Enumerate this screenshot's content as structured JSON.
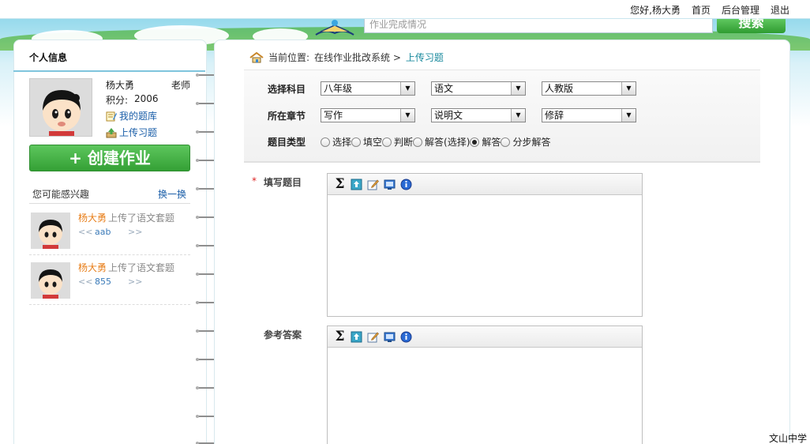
{
  "topbar": {
    "nav": [
      "您好,杨大勇",
      "首页",
      "后台管理",
      "退出"
    ]
  },
  "search": {
    "placeholder": "作业完成情况",
    "button_label": "搜索"
  },
  "sidebar": {
    "title": "个人信息",
    "teacher": {
      "name": "杨大勇",
      "role": "老师",
      "score_label": "积分:",
      "score": "2006"
    },
    "links": [
      {
        "label": "我的题库",
        "icon": "notepad-icon"
      },
      {
        "label": "上传习题",
        "icon": "upload-icon"
      }
    ],
    "create_button": "+ 创建作业",
    "interest": {
      "label": "您可能感兴趣",
      "refresh": "换一换",
      "items": [
        {
          "user": "杨大勇",
          "action": "上传了语文套题",
          "prev": "<<",
          "title": "aab",
          "next": ">>"
        },
        {
          "user": "杨大勇",
          "action": "上传了语文套题",
          "prev": "<<",
          "title": "855",
          "next": ">>"
        }
      ]
    }
  },
  "breadcrumb": {
    "prefix": "当前位置:",
    "path": "在线作业批改系统 >",
    "current": "上传习题"
  },
  "form": {
    "subject": {
      "label": "选择科目",
      "selects": [
        "八年级",
        "语文",
        "人教版"
      ]
    },
    "chapter": {
      "label": "所在章节",
      "selects": [
        "写作",
        "说明文",
        "修辞"
      ]
    },
    "type": {
      "label": "题目类型",
      "options": [
        {
          "label": "选择",
          "checked": false
        },
        {
          "label": "填空",
          "checked": false
        },
        {
          "label": "判断",
          "checked": false
        },
        {
          "label": "解答(选择)",
          "checked": false
        },
        {
          "label": "解答",
          "checked": true
        },
        {
          "label": "分步解答",
          "checked": false
        }
      ]
    },
    "question": {
      "required_mark": "*",
      "label": "填写题目",
      "toolbar": [
        "sigma-icon",
        "image-upload-icon",
        "edit-icon",
        "display-icon",
        "info-icon"
      ]
    },
    "answer": {
      "label": "参考答案",
      "toolbar": [
        "sigma-icon",
        "image-upload-icon",
        "edit-icon",
        "display-icon",
        "info-icon"
      ]
    }
  },
  "footer": {
    "school": "文山中学"
  },
  "colors": {
    "accent_green": "#34a035",
    "link_blue": "#1a5ea8",
    "user_orange": "#e87f1b",
    "breadcrumb_teal": "#1a8a9e"
  }
}
